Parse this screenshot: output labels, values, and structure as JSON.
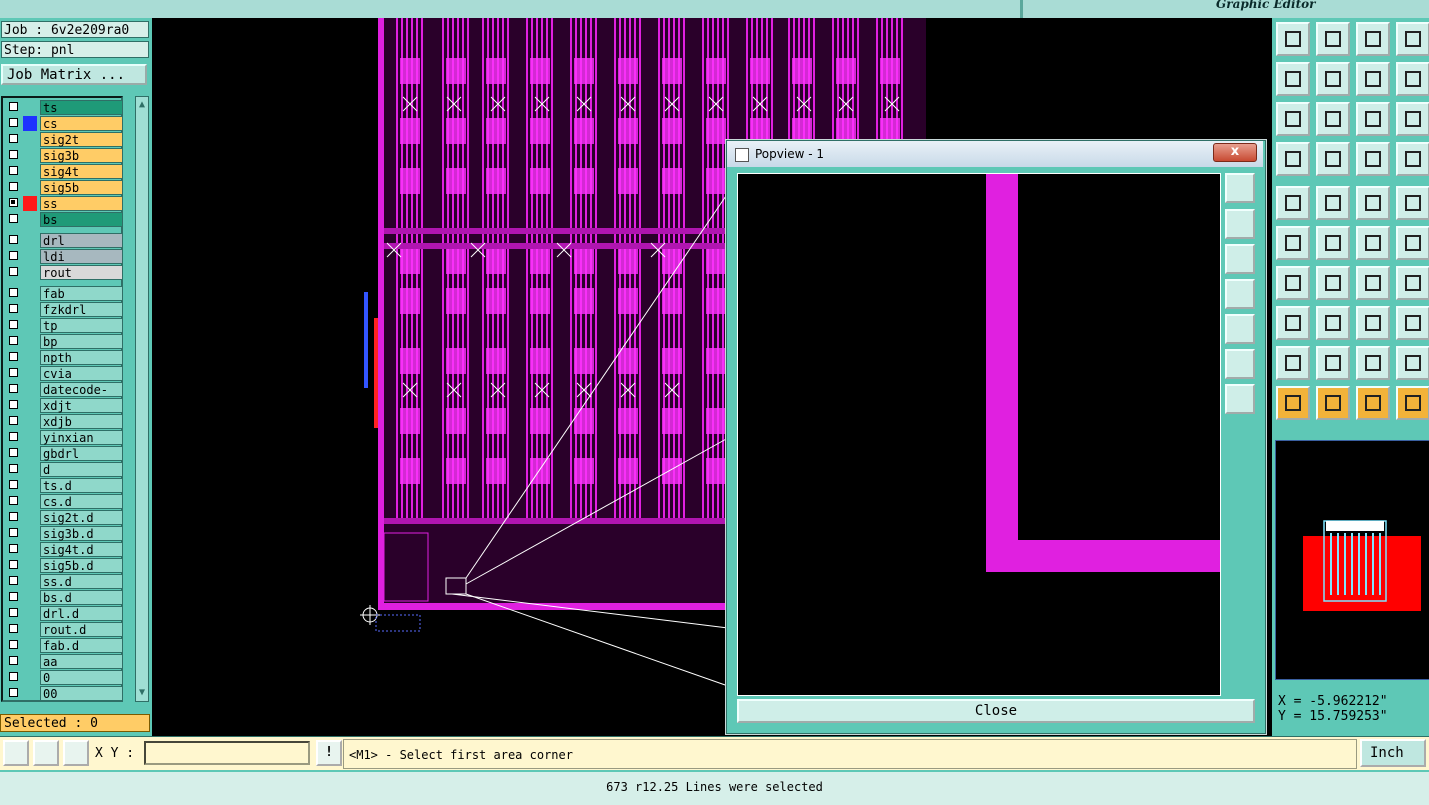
{
  "header": {
    "subtitle": "Graphic Editor"
  },
  "job": {
    "job_line": "Job : 6v2e209ra0",
    "step_line": "Step: pnl",
    "matrix_button": "Job Matrix ..."
  },
  "layers": [
    {
      "name": "ts",
      "bg": "#1f9a78",
      "swatch": "",
      "checked": false
    },
    {
      "name": "cs",
      "bg": "#ffcc66",
      "swatch": "#1e33ff",
      "checked": false
    },
    {
      "name": "sig2t",
      "bg": "#ffcc66",
      "swatch": "",
      "checked": false
    },
    {
      "name": "sig3b",
      "bg": "#ffcc66",
      "swatch": "",
      "checked": false
    },
    {
      "name": "sig4t",
      "bg": "#ffcc66",
      "swatch": "",
      "checked": false
    },
    {
      "name": "sig5b",
      "bg": "#ffcc66",
      "swatch": "",
      "checked": false
    },
    {
      "name": "ss",
      "bg": "#ffcc66",
      "swatch": "#ff1a1a",
      "checked": true
    },
    {
      "name": "bs",
      "bg": "#1f9a78",
      "swatch": "",
      "checked": false
    },
    {
      "name": "drl",
      "bg": "#a7b8bf",
      "swatch": "",
      "checked": false
    },
    {
      "name": "ldi",
      "bg": "#a7b8bf",
      "swatch": "",
      "checked": false
    },
    {
      "name": "rout",
      "bg": "#d9d9d9",
      "swatch": "",
      "checked": false
    },
    {
      "name": "fab",
      "bg": "#8fd8ca",
      "swatch": "",
      "checked": false
    },
    {
      "name": "fzkdrl",
      "bg": "#8fd8ca",
      "swatch": "",
      "checked": false
    },
    {
      "name": "tp",
      "bg": "#8fd8ca",
      "swatch": "",
      "checked": false
    },
    {
      "name": "bp",
      "bg": "#8fd8ca",
      "swatch": "",
      "checked": false
    },
    {
      "name": "npth",
      "bg": "#8fd8ca",
      "swatch": "",
      "checked": false
    },
    {
      "name": "cvia",
      "bg": "#8fd8ca",
      "swatch": "",
      "checked": false
    },
    {
      "name": "datecode-cs",
      "bg": "#8fd8ca",
      "swatch": "",
      "checked": false
    },
    {
      "name": "xdjt",
      "bg": "#8fd8ca",
      "swatch": "",
      "checked": false
    },
    {
      "name": "xdjb",
      "bg": "#8fd8ca",
      "swatch": "",
      "checked": false
    },
    {
      "name": "yinxian",
      "bg": "#8fd8ca",
      "swatch": "",
      "checked": false
    },
    {
      "name": "gbdrl",
      "bg": "#8fd8ca",
      "swatch": "",
      "checked": false
    },
    {
      "name": "d",
      "bg": "#8fd8ca",
      "swatch": "",
      "checked": false
    },
    {
      "name": "ts.d",
      "bg": "#8fd8ca",
      "swatch": "",
      "checked": false
    },
    {
      "name": "cs.d",
      "bg": "#8fd8ca",
      "swatch": "",
      "checked": false
    },
    {
      "name": "sig2t.d",
      "bg": "#8fd8ca",
      "swatch": "",
      "checked": false
    },
    {
      "name": "sig3b.d",
      "bg": "#8fd8ca",
      "swatch": "",
      "checked": false
    },
    {
      "name": "sig4t.d",
      "bg": "#8fd8ca",
      "swatch": "",
      "checked": false
    },
    {
      "name": "sig5b.d",
      "bg": "#8fd8ca",
      "swatch": "",
      "checked": false
    },
    {
      "name": "ss.d",
      "bg": "#8fd8ca",
      "swatch": "",
      "checked": false
    },
    {
      "name": "bs.d",
      "bg": "#8fd8ca",
      "swatch": "",
      "checked": false
    },
    {
      "name": "drl.d",
      "bg": "#8fd8ca",
      "swatch": "",
      "checked": false
    },
    {
      "name": "rout.d",
      "bg": "#8fd8ca",
      "swatch": "",
      "checked": false
    },
    {
      "name": "fab.d",
      "bg": "#8fd8ca",
      "swatch": "",
      "checked": false
    },
    {
      "name": "aa",
      "bg": "#8fd8ca",
      "swatch": "",
      "checked": false
    },
    {
      "name": "0",
      "bg": "#8fd8ca",
      "swatch": "",
      "checked": false
    },
    {
      "name": "00",
      "bg": "#8fd8ca",
      "swatch": "",
      "checked": false
    }
  ],
  "selected_label": "Selected : 0",
  "popview": {
    "title": "Popview - 1",
    "close_x": "x",
    "close_button": "Close"
  },
  "coords": {
    "x": "X = -5.962212\"",
    "y": "Y = 15.759253\""
  },
  "command": {
    "xy_label": "X Y :",
    "xy_value": "",
    "message": "<M1> - Select first area corner",
    "unit": "Inch"
  },
  "status": "673 r12.25 Lines were selected",
  "colors": {
    "panel": "#5ec8b6",
    "highlight": "#ffcc66",
    "trace": "#e020e0"
  },
  "toolbar_icons": [
    "zoom-home-icon",
    "zoom-in-icon",
    "home-icon",
    "window-icon",
    "zoom-left-icon",
    "zoom-right-icon",
    "redo-icon",
    "snap-icon",
    "fit-icon",
    "center-icon",
    "one-to-one-icon",
    "help-icon",
    "settings-icon",
    "grid-icon",
    "measure-net-icon",
    "measure-pad-icon",
    "feature-icon",
    "select-area-icon",
    "ruler-icon",
    "pad-icon",
    "net-icon",
    "cross-icon",
    "snap-point-icon",
    "arrow-point-icon",
    "line-icon",
    "slash-icon",
    "arc-icon",
    "ff-icon",
    "node-icon",
    "minus-icon",
    "box-icon",
    "shapes-icon",
    "tri1-icon",
    "tri2-icon",
    "tri3-icon",
    "tri4-icon",
    "pointer-icon",
    "pointer-box-icon",
    "pointer-rot-icon",
    "connect-icon"
  ]
}
